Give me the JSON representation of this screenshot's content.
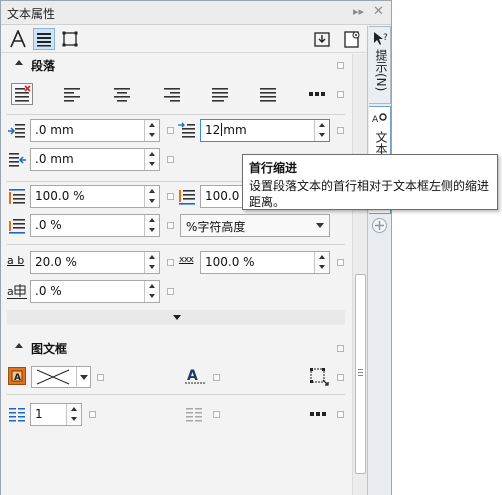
{
  "panel": {
    "title": "文本属性"
  },
  "sidetabs": {
    "hint_label": "提示(N)",
    "text_label": "文本"
  },
  "paragraph": {
    "section_title": "段落",
    "left_indent": {
      "value": ".0 mm"
    },
    "first_line_indent": {
      "value": "12 mm",
      "typed": "12",
      "unit": "mm"
    },
    "right_indent": {
      "value": ".0 mm"
    },
    "para_spacing_before": {
      "value": "100.0 %"
    },
    "para_spacing_after": {
      "value": "100.0 %"
    },
    "line_spacing": {
      "value": ".0 %"
    },
    "line_spacing_unit": {
      "selected": "%字符高度"
    },
    "char_spacing": {
      "value": "20.0 %"
    },
    "word_spacing": {
      "value": "100.0 %"
    },
    "language_spacing": {
      "value": ".0 %"
    }
  },
  "frame": {
    "section_title": "图文框",
    "columns": {
      "value": "1"
    }
  },
  "tooltip": {
    "title": "首行缩进",
    "body": "设置段落文本的首行相对于文本框左侧的缩进距离。"
  },
  "colors": {
    "accent": "#3b8ad8",
    "panel_bg": "#f3f3f3",
    "icon_blue": "#1f66c4",
    "icon_orange": "#e2731c"
  }
}
